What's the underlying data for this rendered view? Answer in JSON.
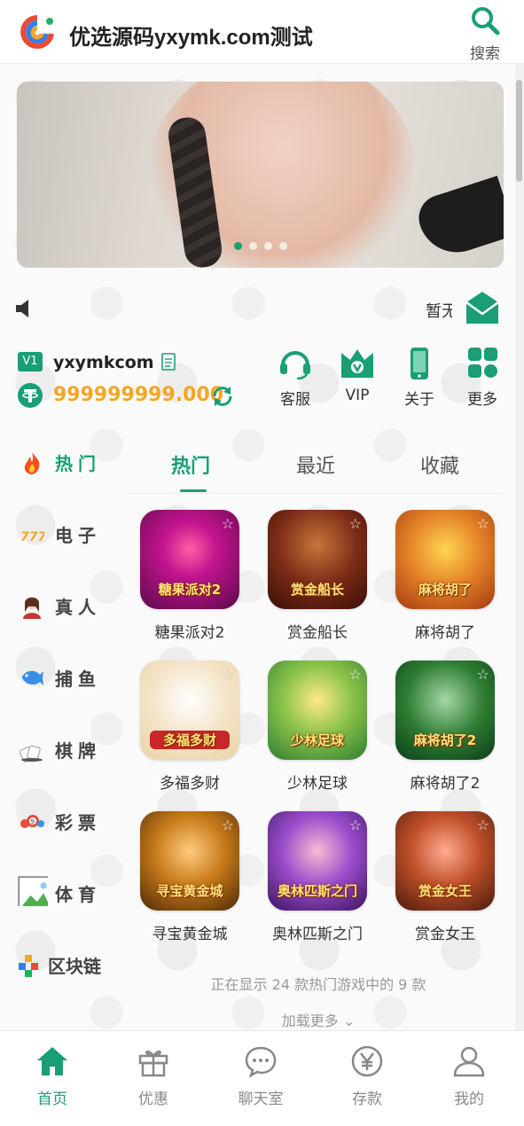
{
  "header": {
    "title": "优选源码yxymk.com测试",
    "search_label": "搜索"
  },
  "notice": {
    "text": "暂无公告"
  },
  "user": {
    "vip": "V1",
    "name": "yxymkcom",
    "balance": "999999999.000"
  },
  "quick_links": [
    {
      "label": "客服",
      "icon": "headset-icon"
    },
    {
      "label": "VIP",
      "icon": "vip-shield-icon"
    },
    {
      "label": "关于",
      "icon": "phone-icon"
    },
    {
      "label": "更多",
      "icon": "grid-icon"
    }
  ],
  "categories": [
    {
      "label": "热门",
      "icon": "fire-icon",
      "active": true
    },
    {
      "label": "电子",
      "icon": "slot-777-icon"
    },
    {
      "label": "真人",
      "icon": "dealer-icon"
    },
    {
      "label": "捕鱼",
      "icon": "fish-icon"
    },
    {
      "label": "棋牌",
      "icon": "cards-icon"
    },
    {
      "label": "彩票",
      "icon": "lottery-balls-icon"
    },
    {
      "label": "体育",
      "icon": "broken-image-icon"
    },
    {
      "label": "区块链",
      "icon": "blocks-icon"
    }
  ],
  "tabs": [
    {
      "label": "热门",
      "active": true
    },
    {
      "label": "最近"
    },
    {
      "label": "收藏"
    }
  ],
  "games": [
    {
      "name": "糖果派对2",
      "art": "糖果派对2"
    },
    {
      "name": "赏金船长",
      "art": "赏金船长"
    },
    {
      "name": "麻将胡了",
      "art": "麻将胡了"
    },
    {
      "name": "多福多财",
      "art": "多福多财"
    },
    {
      "name": "少林足球",
      "art": "少林足球"
    },
    {
      "name": "麻将胡了2",
      "art": "麻将胡了2"
    },
    {
      "name": "寻宝黄金城",
      "art": "寻宝黄金城"
    },
    {
      "name": "奥林匹斯之门",
      "art": "奥林匹斯之门"
    },
    {
      "name": "赏金女王",
      "art": "赏金女王"
    }
  ],
  "games_status": "正在显示 24 款热门游戏中的 9 款",
  "load_more": "加载更多",
  "bottom_nav": [
    {
      "label": "首页",
      "icon": "home-icon",
      "active": true
    },
    {
      "label": "优惠",
      "icon": "gift-icon"
    },
    {
      "label": "聊天室",
      "icon": "chat-icon"
    },
    {
      "label": "存款",
      "icon": "yen-icon"
    },
    {
      "label": "我的",
      "icon": "user-icon"
    }
  ],
  "colors": {
    "accent": "#1a9e76",
    "balance": "#f5a623"
  }
}
